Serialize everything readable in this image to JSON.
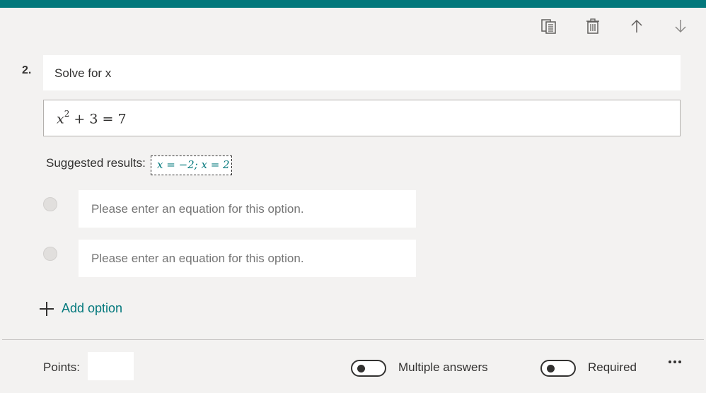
{
  "question": {
    "number": "2.",
    "title": "Solve for x",
    "equation": {
      "base": "x",
      "exponent": "2",
      "rest": " + 3 = 7"
    },
    "suggested_label": "Suggested results:",
    "suggested_value": "x = −2; x = 2"
  },
  "toolbar": {
    "icons": [
      "copy-icon",
      "delete-icon",
      "move-up-icon",
      "move-down-icon"
    ]
  },
  "options": [
    {
      "placeholder": "Please enter an equation for this option.",
      "value": ""
    },
    {
      "placeholder": "Please enter an equation for this option.",
      "value": ""
    }
  ],
  "add_option_label": "Add option",
  "footer": {
    "points_label": "Points:",
    "points_value": "",
    "multiple_answers_label": "Multiple answers",
    "multiple_answers_on": false,
    "required_label": "Required",
    "required_on": false
  },
  "colors": {
    "accent": "#03787c",
    "background": "#f3f2f1",
    "text": "#323130",
    "placeholder": "#8a8886"
  }
}
